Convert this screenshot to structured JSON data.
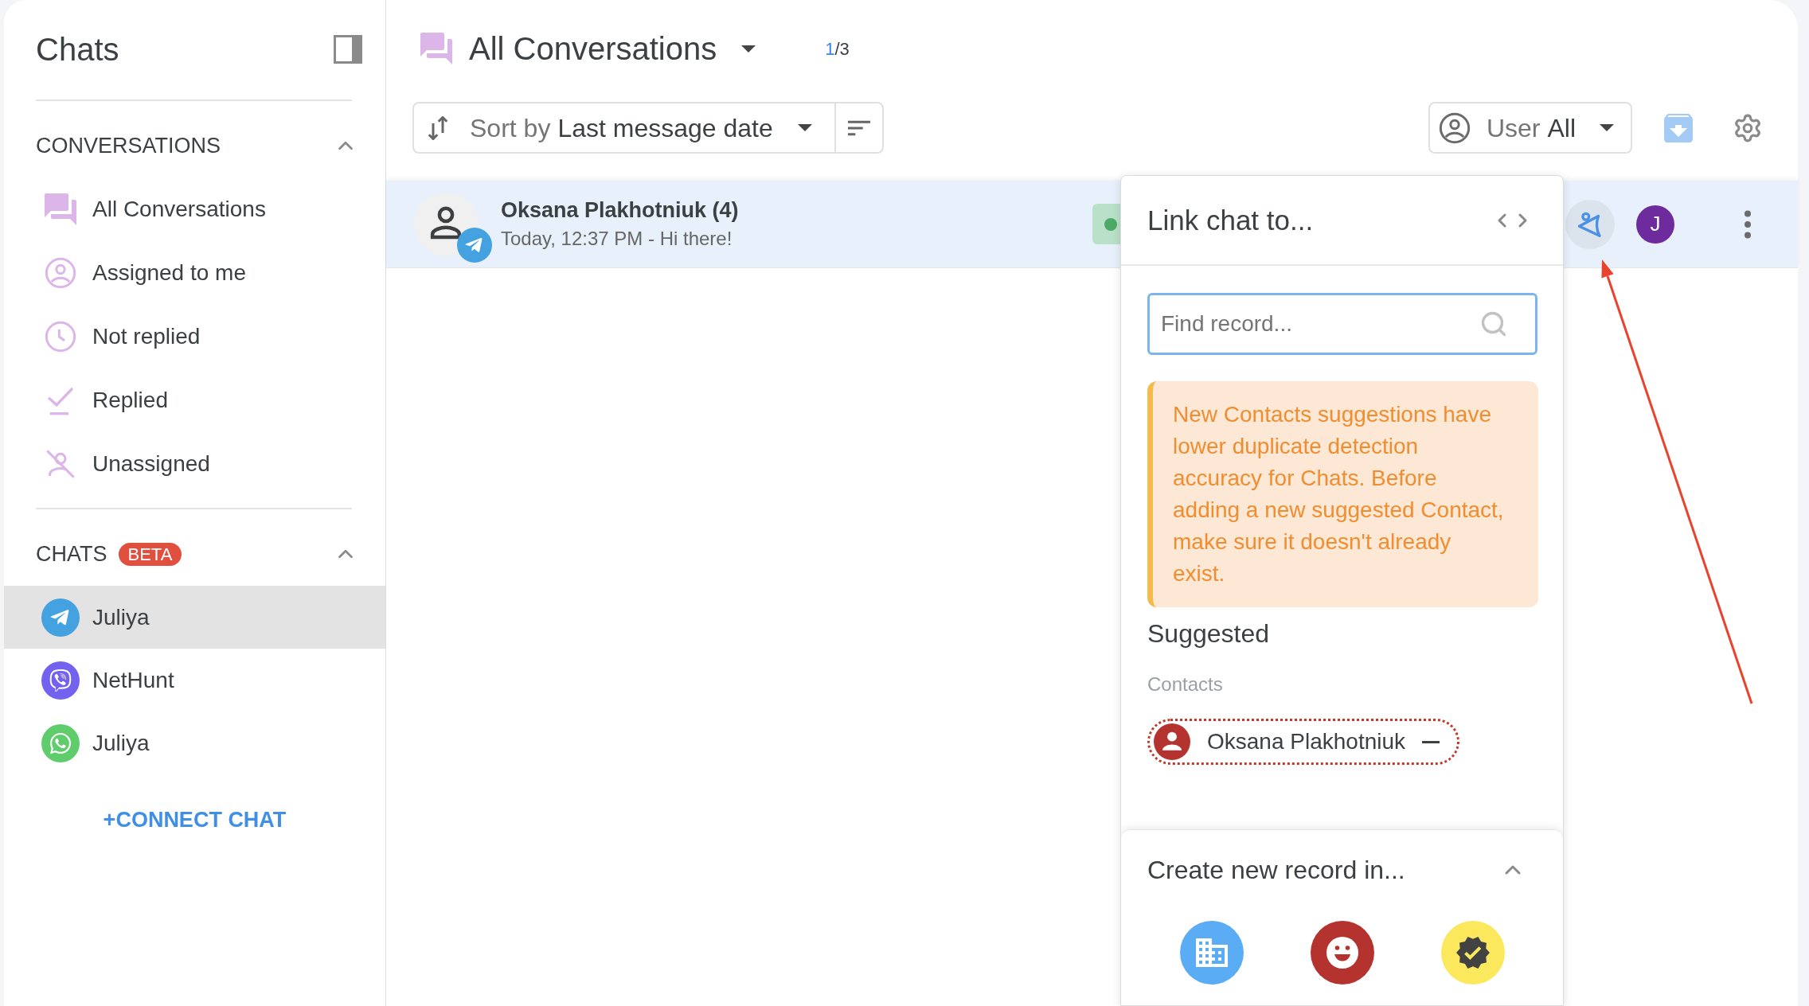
{
  "sidebar": {
    "title": "Chats",
    "sections": [
      {
        "kind": "filters",
        "heading": "CONVERSATIONS",
        "expanded": true,
        "items": [
          {
            "label": "All Conversations"
          },
          {
            "label": "Assigned to me"
          },
          {
            "label": "Not replied"
          },
          {
            "label": "Replied"
          },
          {
            "label": "Unassigned"
          }
        ]
      },
      {
        "kind": "channels",
        "heading": "CHATS",
        "badge": "BETA",
        "expanded": true,
        "items": [
          {
            "label": "Juliya",
            "selected": true
          },
          {
            "label": "NetHunt",
            "selected": false
          },
          {
            "label": "Juliya",
            "selected": false
          }
        ]
      }
    ],
    "connect_button": "+CONNECT CHAT"
  },
  "header": {
    "title": "All Conversations",
    "pager": {
      "current": "1",
      "rest": "/3"
    }
  },
  "toolbar": {
    "sort": {
      "label": "Sort by",
      "value": "Last message date"
    },
    "user_filter": {
      "label": "User",
      "value": "All"
    }
  },
  "conversations": [
    {
      "name": "Oksana Plakhotniuk (4)",
      "preview": "Today, 12:37 PM - Hi there!",
      "selected": true,
      "assignee": "J"
    }
  ],
  "link_popup": {
    "title": "Link chat to...",
    "search": {
      "placeholder": "Find record...",
      "focused": true
    },
    "notice": "New Contacts suggestions have lower duplicate detection accuracy for Chats. Before adding a new suggested Contact, make sure it doesn't already exist.",
    "suggested_heading": "Suggested",
    "groups": [
      {
        "label": "Contacts",
        "items": [
          {
            "name": "Oksana Plakhotniuk"
          }
        ]
      }
    ],
    "create": {
      "heading": "Create new record in...",
      "expanded": true,
      "targets": [
        {
          "color": "#5aacf5"
        },
        {
          "color": "#b5332e"
        },
        {
          "color": "#fce85d"
        }
      ]
    }
  }
}
